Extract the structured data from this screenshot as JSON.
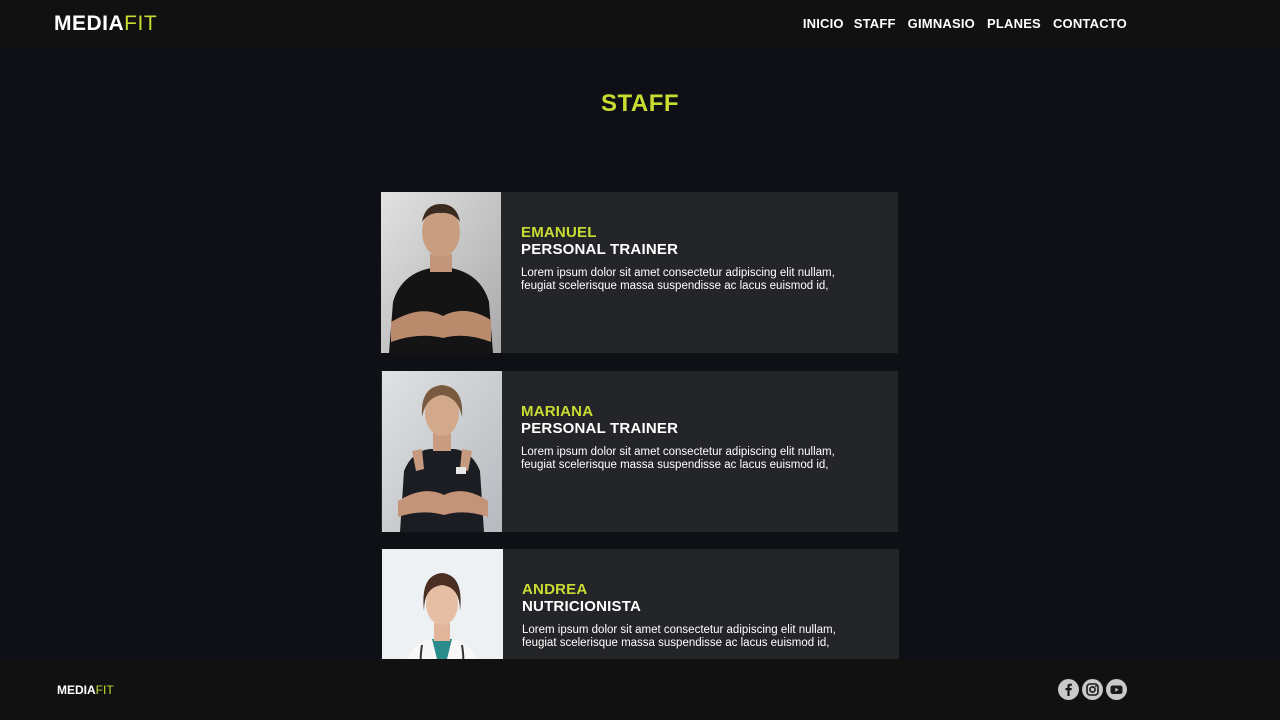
{
  "header": {
    "logo_part1": "MEDIA",
    "logo_part2": "FIT",
    "nav": [
      "INICIO",
      "STAFF",
      "GIMNASIO",
      "PLANES",
      "CONTACTO"
    ]
  },
  "main": {
    "title": "STAFF",
    "staff": [
      {
        "name": "EMANUEL",
        "role": "PERSONAL TRAINER",
        "description": "Lorem ipsum dolor sit amet consectetur adipiscing elit nullam, feugiat scelerisque massa suspendisse ac lacus euismod id,"
      },
      {
        "name": "MARIANA",
        "role": "PERSONAL TRAINER",
        "description": "Lorem ipsum dolor sit amet consectetur adipiscing elit nullam, feugiat scelerisque massa suspendisse ac lacus euismod id,"
      },
      {
        "name": "ANDREA",
        "role": "NUTRICIONISTA",
        "description": "Lorem ipsum dolor sit amet consectetur adipiscing elit nullam, feugiat scelerisque massa suspendisse ac lacus euismod id,"
      }
    ]
  },
  "footer": {
    "logo_part1": "MEDIA",
    "logo_part2": "FIT",
    "social_icons": [
      "facebook-icon",
      "instagram-icon",
      "youtube-icon"
    ]
  },
  "colors": {
    "accent": "#c8dc32",
    "background": "#0f1015",
    "card": "#242528",
    "bar": "#111111"
  }
}
